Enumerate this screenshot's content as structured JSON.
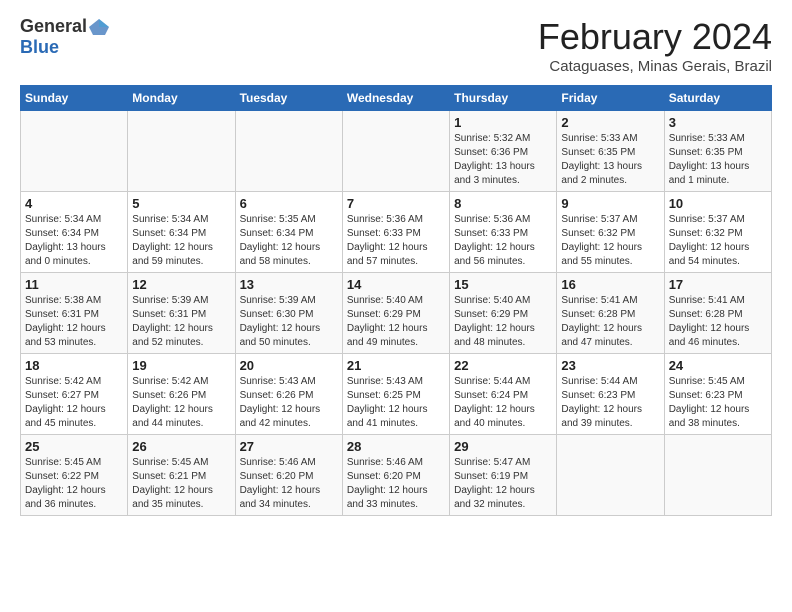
{
  "header": {
    "logo_general": "General",
    "logo_blue": "Blue",
    "main_title": "February 2024",
    "subtitle": "Cataguases, Minas Gerais, Brazil"
  },
  "weekdays": [
    "Sunday",
    "Monday",
    "Tuesday",
    "Wednesday",
    "Thursday",
    "Friday",
    "Saturday"
  ],
  "weeks": [
    [
      {
        "day": "",
        "info": ""
      },
      {
        "day": "",
        "info": ""
      },
      {
        "day": "",
        "info": ""
      },
      {
        "day": "",
        "info": ""
      },
      {
        "day": "1",
        "info": "Sunrise: 5:32 AM\nSunset: 6:36 PM\nDaylight: 13 hours\nand 3 minutes."
      },
      {
        "day": "2",
        "info": "Sunrise: 5:33 AM\nSunset: 6:35 PM\nDaylight: 13 hours\nand 2 minutes."
      },
      {
        "day": "3",
        "info": "Sunrise: 5:33 AM\nSunset: 6:35 PM\nDaylight: 13 hours\nand 1 minute."
      }
    ],
    [
      {
        "day": "4",
        "info": "Sunrise: 5:34 AM\nSunset: 6:34 PM\nDaylight: 13 hours\nand 0 minutes."
      },
      {
        "day": "5",
        "info": "Sunrise: 5:34 AM\nSunset: 6:34 PM\nDaylight: 12 hours\nand 59 minutes."
      },
      {
        "day": "6",
        "info": "Sunrise: 5:35 AM\nSunset: 6:34 PM\nDaylight: 12 hours\nand 58 minutes."
      },
      {
        "day": "7",
        "info": "Sunrise: 5:36 AM\nSunset: 6:33 PM\nDaylight: 12 hours\nand 57 minutes."
      },
      {
        "day": "8",
        "info": "Sunrise: 5:36 AM\nSunset: 6:33 PM\nDaylight: 12 hours\nand 56 minutes."
      },
      {
        "day": "9",
        "info": "Sunrise: 5:37 AM\nSunset: 6:32 PM\nDaylight: 12 hours\nand 55 minutes."
      },
      {
        "day": "10",
        "info": "Sunrise: 5:37 AM\nSunset: 6:32 PM\nDaylight: 12 hours\nand 54 minutes."
      }
    ],
    [
      {
        "day": "11",
        "info": "Sunrise: 5:38 AM\nSunset: 6:31 PM\nDaylight: 12 hours\nand 53 minutes."
      },
      {
        "day": "12",
        "info": "Sunrise: 5:39 AM\nSunset: 6:31 PM\nDaylight: 12 hours\nand 52 minutes."
      },
      {
        "day": "13",
        "info": "Sunrise: 5:39 AM\nSunset: 6:30 PM\nDaylight: 12 hours\nand 50 minutes."
      },
      {
        "day": "14",
        "info": "Sunrise: 5:40 AM\nSunset: 6:29 PM\nDaylight: 12 hours\nand 49 minutes."
      },
      {
        "day": "15",
        "info": "Sunrise: 5:40 AM\nSunset: 6:29 PM\nDaylight: 12 hours\nand 48 minutes."
      },
      {
        "day": "16",
        "info": "Sunrise: 5:41 AM\nSunset: 6:28 PM\nDaylight: 12 hours\nand 47 minutes."
      },
      {
        "day": "17",
        "info": "Sunrise: 5:41 AM\nSunset: 6:28 PM\nDaylight: 12 hours\nand 46 minutes."
      }
    ],
    [
      {
        "day": "18",
        "info": "Sunrise: 5:42 AM\nSunset: 6:27 PM\nDaylight: 12 hours\nand 45 minutes."
      },
      {
        "day": "19",
        "info": "Sunrise: 5:42 AM\nSunset: 6:26 PM\nDaylight: 12 hours\nand 44 minutes."
      },
      {
        "day": "20",
        "info": "Sunrise: 5:43 AM\nSunset: 6:26 PM\nDaylight: 12 hours\nand 42 minutes."
      },
      {
        "day": "21",
        "info": "Sunrise: 5:43 AM\nSunset: 6:25 PM\nDaylight: 12 hours\nand 41 minutes."
      },
      {
        "day": "22",
        "info": "Sunrise: 5:44 AM\nSunset: 6:24 PM\nDaylight: 12 hours\nand 40 minutes."
      },
      {
        "day": "23",
        "info": "Sunrise: 5:44 AM\nSunset: 6:23 PM\nDaylight: 12 hours\nand 39 minutes."
      },
      {
        "day": "24",
        "info": "Sunrise: 5:45 AM\nSunset: 6:23 PM\nDaylight: 12 hours\nand 38 minutes."
      }
    ],
    [
      {
        "day": "25",
        "info": "Sunrise: 5:45 AM\nSunset: 6:22 PM\nDaylight: 12 hours\nand 36 minutes."
      },
      {
        "day": "26",
        "info": "Sunrise: 5:45 AM\nSunset: 6:21 PM\nDaylight: 12 hours\nand 35 minutes."
      },
      {
        "day": "27",
        "info": "Sunrise: 5:46 AM\nSunset: 6:20 PM\nDaylight: 12 hours\nand 34 minutes."
      },
      {
        "day": "28",
        "info": "Sunrise: 5:46 AM\nSunset: 6:20 PM\nDaylight: 12 hours\nand 33 minutes."
      },
      {
        "day": "29",
        "info": "Sunrise: 5:47 AM\nSunset: 6:19 PM\nDaylight: 12 hours\nand 32 minutes."
      },
      {
        "day": "",
        "info": ""
      },
      {
        "day": "",
        "info": ""
      }
    ]
  ]
}
